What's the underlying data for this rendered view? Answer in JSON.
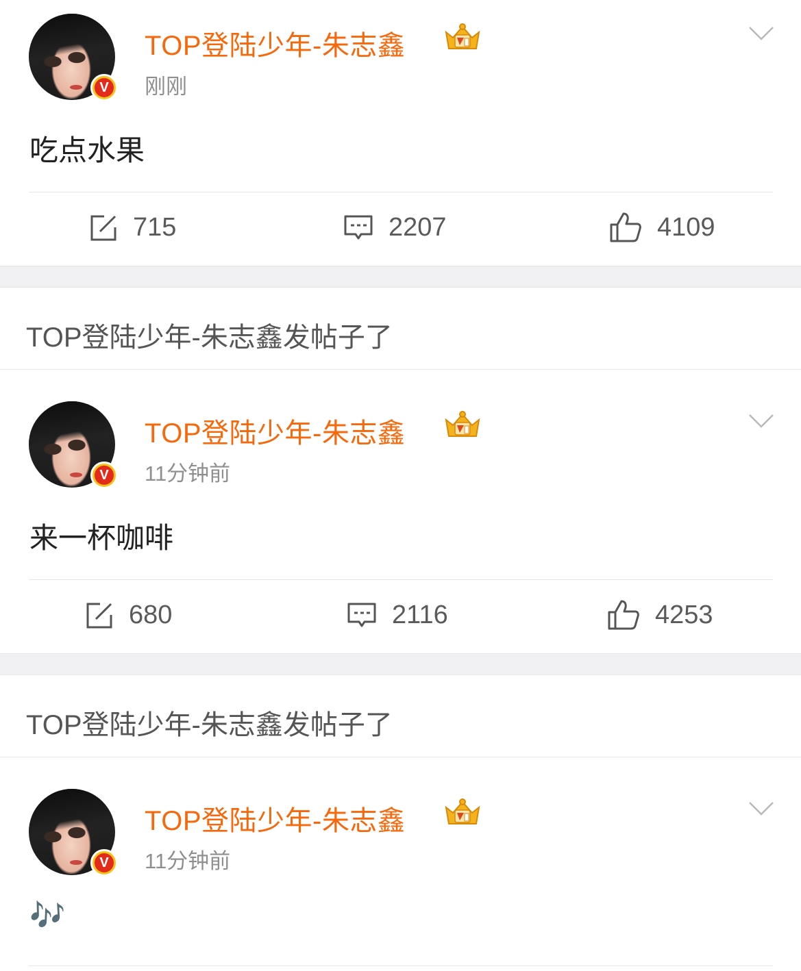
{
  "posts": [
    {
      "author": "TOP登陆少年-朱志鑫",
      "time": "刚刚",
      "content": "吃点水果",
      "reposts": "715",
      "comments": "2207",
      "likes": "4109"
    },
    {
      "author": "TOP登陆少年-朱志鑫",
      "time": "11分钟前",
      "content": "来一杯咖啡",
      "reposts": "680",
      "comments": "2116",
      "likes": "4253"
    },
    {
      "author": "TOP登陆少年-朱志鑫",
      "time": "11分钟前",
      "content": "🎶"
    }
  ],
  "notices": [
    "TOP登陆少年-朱志鑫发帖子了",
    "TOP登陆少年-朱志鑫发帖子了"
  ],
  "verified_badge": "V",
  "colors": {
    "author": "#f5690c",
    "time": "#8f8f8f",
    "content": "#222222",
    "action": "#5a5a5a",
    "separator": "#f1f1f3",
    "badge_outer": "#f6c21a",
    "badge_inner": "#e32b1b"
  },
  "icons": [
    "verified-v-icon",
    "crown-badge-icon",
    "chevron-down-icon",
    "repost-icon",
    "comment-icon",
    "like-icon"
  ]
}
